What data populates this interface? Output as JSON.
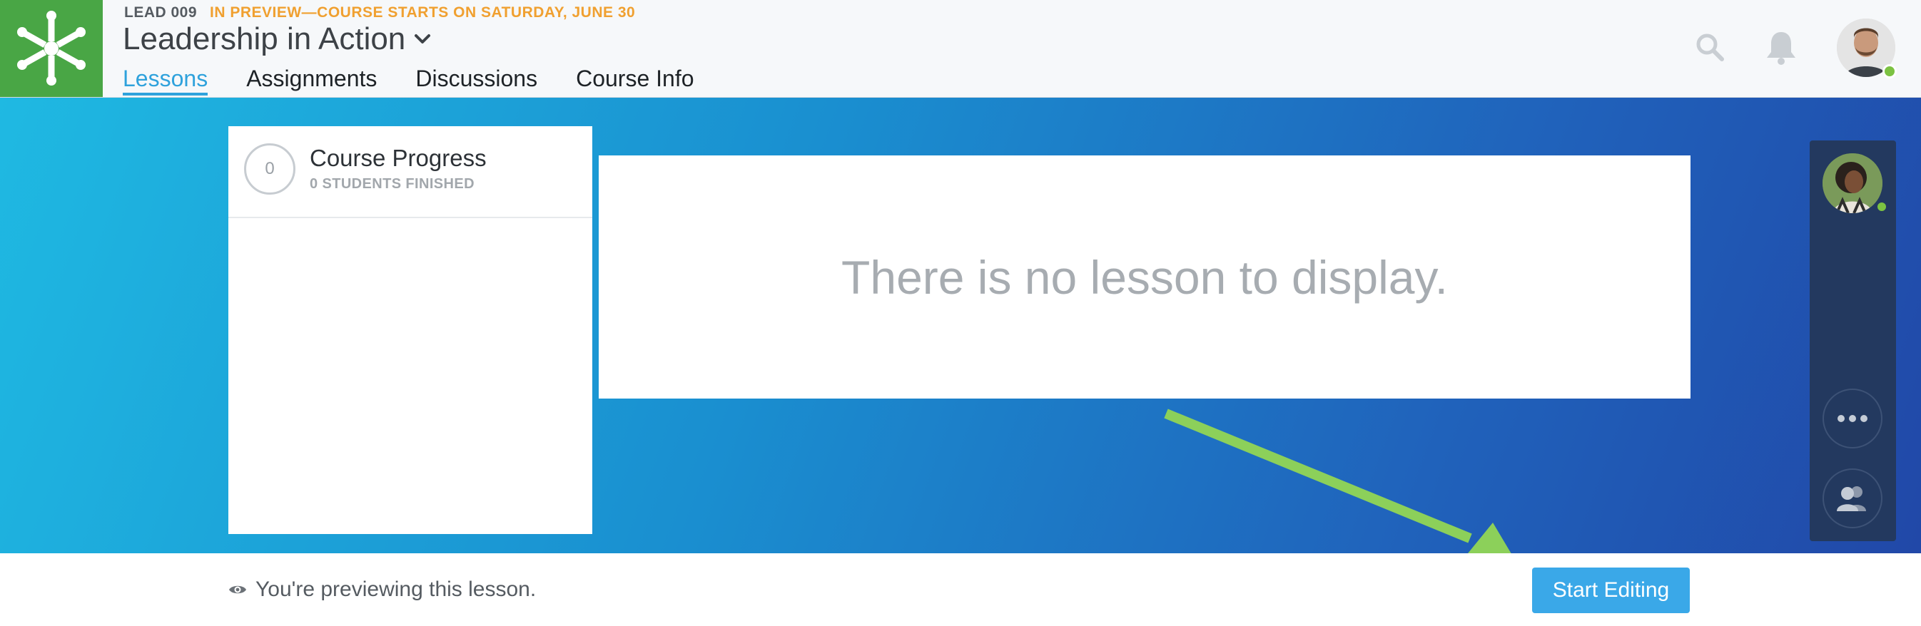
{
  "header": {
    "course_code": "LEAD 009",
    "preview_note": "IN PREVIEW—COURSE STARTS ON SATURDAY, JUNE 30",
    "course_title": "Leadership in Action",
    "tabs": [
      {
        "label": "Lessons",
        "active": true
      },
      {
        "label": "Assignments",
        "active": false
      },
      {
        "label": "Discussions",
        "active": false
      },
      {
        "label": "Course Info",
        "active": false
      }
    ],
    "icons": [
      "search-icon",
      "bell-icon",
      "user-avatar"
    ]
  },
  "progress": {
    "count": "0",
    "title": "Course Progress",
    "subtitle": "0 STUDENTS FINISHED"
  },
  "lesson": {
    "empty_message": "There is no lesson to display."
  },
  "sidebar": {
    "icons": [
      "student-avatar",
      "more-icon",
      "people-icon"
    ]
  },
  "footer": {
    "preview_message": "You're previewing this lesson.",
    "start_editing_label": "Start Editing"
  },
  "colors": {
    "brand_green": "#49a645",
    "accent_blue": "#2fa2dc",
    "preview_orange": "#f0a030",
    "button_blue": "#3aa8e8",
    "online_green": "#7cc242",
    "annotation_arrow": "#8cd05a"
  }
}
